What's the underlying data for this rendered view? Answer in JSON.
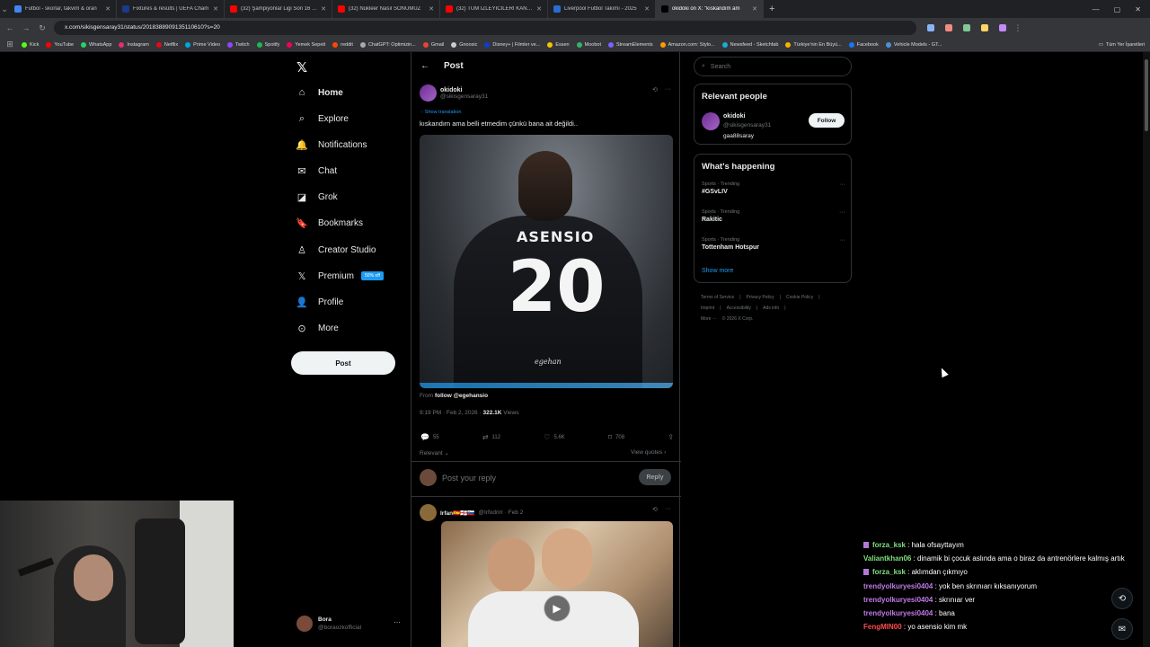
{
  "browser": {
    "tabs": [
      {
        "title": "Futbol - skorlar, takvim & oran",
        "color": "#4285f4"
      },
      {
        "title": "Fixtures & results | UEFA Cham",
        "color": "#1a3a8a"
      },
      {
        "title": "(32) Şampiyonlar Ligi Son 16 Tu",
        "color": "#ff0000"
      },
      {
        "title": "(32) Nükleer Nasıl SONUMUZ",
        "color": "#ff0000"
      },
      {
        "title": "(32) TÜM İZLEYİCİLERİ KANDIR",
        "color": "#ff0000"
      },
      {
        "title": "Liverpool Futbol Takımı - 2025",
        "color": "#2b6cd4"
      },
      {
        "title": "okidoki on X: \"kıskandım am",
        "color": "#000000",
        "active": true
      }
    ],
    "url": "x.com/sikisgensaray31/status/2018388909135110610?s=20",
    "bookmarks": [
      {
        "label": "Kick",
        "color": "#53fc18"
      },
      {
        "label": "YouTube",
        "color": "#ff0000"
      },
      {
        "label": "WhatsApp",
        "color": "#25d366"
      },
      {
        "label": "Instagram",
        "color": "#e1306c"
      },
      {
        "label": "Netflix",
        "color": "#e50914"
      },
      {
        "label": "Prime Video",
        "color": "#00a8e1"
      },
      {
        "label": "Twitch",
        "color": "#9146ff"
      },
      {
        "label": "Spotify",
        "color": "#1db954"
      },
      {
        "label": "Yemek Sepeti",
        "color": "#fa0050"
      },
      {
        "label": "reddit",
        "color": "#ff4500"
      },
      {
        "label": "ChatGPT: Optimizin...",
        "color": "#aaaaaa"
      },
      {
        "label": "Gmail",
        "color": "#ea4335"
      },
      {
        "label": "Gnoosic",
        "color": "#cccccc"
      },
      {
        "label": "Disney+ | Filmler ve...",
        "color": "#113ccf"
      },
      {
        "label": "Essen",
        "color": "#f5c400"
      },
      {
        "label": "Moobot",
        "color": "#35b36b"
      },
      {
        "label": "StreamElements",
        "color": "#7b61ff"
      },
      {
        "label": "Amazon.com: Stylo...",
        "color": "#ff9900"
      },
      {
        "label": "Newsfeed - Sketchfab",
        "color": "#1caad9"
      },
      {
        "label": "Türkiye'nin En Büyü...",
        "color": "#f6b400"
      },
      {
        "label": "Facebook",
        "color": "#1877f2"
      },
      {
        "label": "Vehicle Models - GT...",
        "color": "#4a90d9"
      }
    ],
    "bookmarks_all": "Tüm Yer İşaretleri"
  },
  "nav": {
    "items": [
      {
        "label": "Home",
        "icon": "home-icon",
        "glyph": "⌂"
      },
      {
        "label": "Explore",
        "icon": "search-icon",
        "glyph": "⌕"
      },
      {
        "label": "Notifications",
        "icon": "bell-icon",
        "glyph": "🔔"
      },
      {
        "label": "Chat",
        "icon": "mail-icon",
        "glyph": "✉"
      },
      {
        "label": "Grok",
        "icon": "grok-icon",
        "glyph": "◪"
      },
      {
        "label": "Bookmarks",
        "icon": "bookmark-icon",
        "glyph": "🔖"
      },
      {
        "label": "Creator Studio",
        "icon": "creator-icon",
        "glyph": "♙"
      },
      {
        "label": "Premium",
        "icon": "x-icon",
        "glyph": "𝕏"
      },
      {
        "label": "Profile",
        "icon": "person-icon",
        "glyph": "👤"
      },
      {
        "label": "More",
        "icon": "more-circle-icon",
        "glyph": "⊙"
      }
    ],
    "premium_badge": "50% off",
    "post_label": "Post",
    "account": {
      "display_name": "Bora",
      "username": "@boraozkofficial"
    }
  },
  "post": {
    "header": "Post",
    "author": {
      "display_name": "okidoki",
      "username": "@sikisgensaray31"
    },
    "show_translation": "Show translation",
    "text": "kıskandım ama belli etmedim çünkü bana ait değildi..",
    "jersey_name": "ASENSIO",
    "jersey_number": "20",
    "signature": "egehan",
    "from_prefix": "From",
    "from_account": "follow @egehansio",
    "time": "9:19 PM · Feb 2, 2026 ·",
    "views_count": "322.1K",
    "views_label": "Views",
    "stats": {
      "replies": "55",
      "reposts": "112",
      "likes": "5.6K",
      "bookmarks": "708"
    },
    "relevant": "Relevant ⌄",
    "view_quotes": "View quotes ›",
    "reply_placeholder": "Post your reply",
    "reply_button": "Reply"
  },
  "reply2": {
    "display_name": "Irfan🇪🇸🏴󠁧󠁢󠁥󠁮󠁧󠁿🇸🇮",
    "username": "@Irfodrirr · Feb 2"
  },
  "sidebar": {
    "search_placeholder": "Search",
    "relevant_title": "Relevant people",
    "relevant_person": {
      "display_name": "okidoki",
      "username": "@sikisgensaray31",
      "bio": "gaa88saray"
    },
    "follow_label": "Follow",
    "happening_title": "What's happening",
    "trends": [
      {
        "category": "Sports · Trending",
        "name": "#GSvLIV"
      },
      {
        "category": "Sports · Trending",
        "name": "Rakitic"
      },
      {
        "category": "Sports · Trending",
        "name": "Tottenham Hotspur"
      }
    ],
    "show_more": "Show more",
    "footer": [
      "Terms of Service",
      "|",
      "Privacy Policy",
      "|",
      "Cookie Policy",
      "|",
      "Imprint",
      "|",
      "Accessibility",
      "|",
      "Ads info",
      "|",
      "More ···",
      "© 2026 X Corp."
    ]
  },
  "chat": [
    {
      "user": "forza_ksk",
      "color": "#7fe07f",
      "text": "hala ofsayttayım",
      "badge": true
    },
    {
      "user": "Valiantkhan06",
      "color": "#7fe07f",
      "text": "dinamik bi çocuk aslında ama o biraz da antrenörlere kalmış artık",
      "badge": false
    },
    {
      "user": "forza_ksk",
      "color": "#7fe07f",
      "text": "aklımdan çıkmıyo",
      "badge": true
    },
    {
      "user": "trendyolkuryesi0404",
      "color": "#c07ae8",
      "text": "yok ben skrınıarı kıksanıyorum",
      "badge": false
    },
    {
      "user": "trendyolkuryesi0404",
      "color": "#c07ae8",
      "text": "skrınıar ver",
      "badge": false
    },
    {
      "user": "trendyolkuryesi0404",
      "color": "#c07ae8",
      "text": "bana",
      "badge": false
    },
    {
      "user": "FengMIN00",
      "color": "#ff4d4d",
      "text": "yo asensio kim mk",
      "badge": false
    }
  ]
}
